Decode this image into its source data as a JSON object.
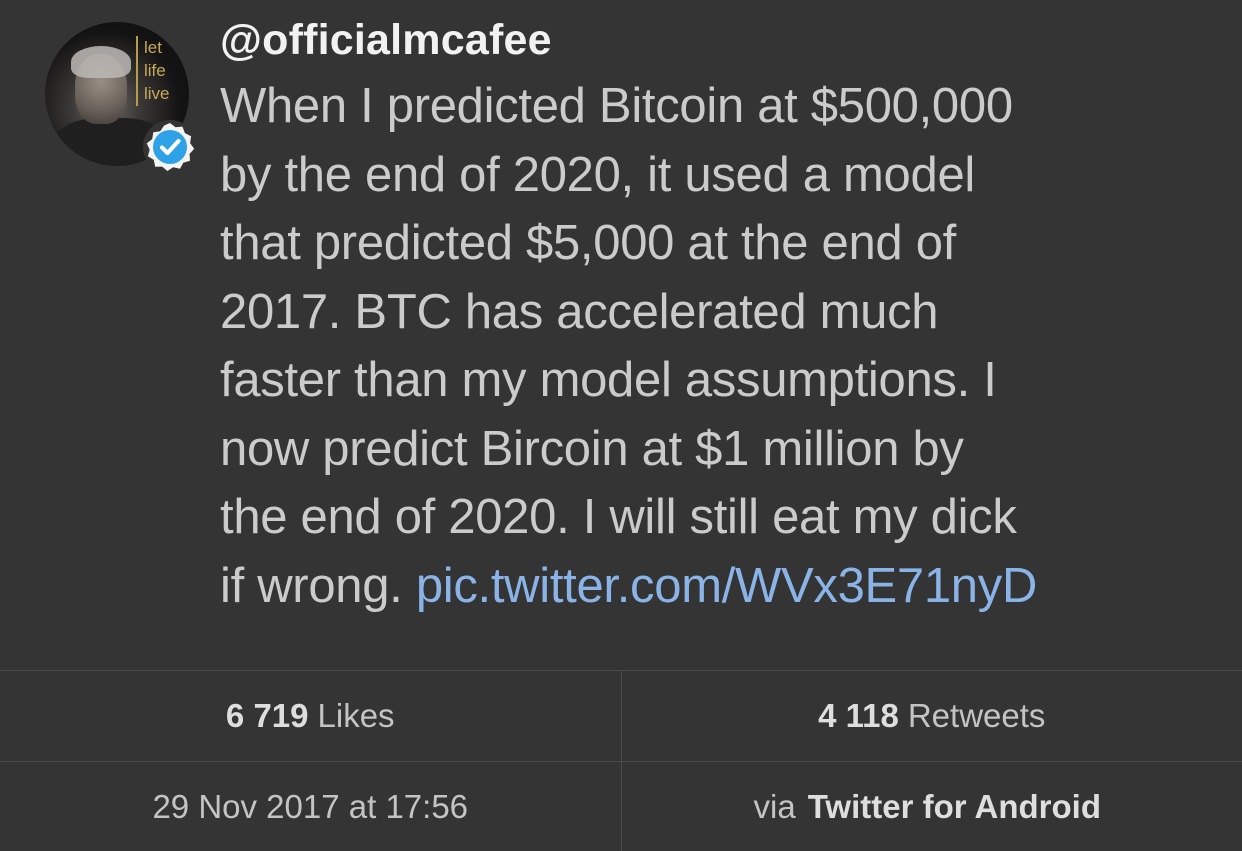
{
  "tweet": {
    "handle": "@officialmcafee",
    "avatar_logo": [
      "let",
      "life",
      "live"
    ],
    "verified_icon": "verified-badge-icon",
    "text_lines": [
      "When I predicted Bitcoin at $500,000",
      "by the end of 2020, it used a model",
      "that predicted $5,000 at the end of",
      "2017. BTC has accelerated much",
      "faster than my model assumptions. I",
      "now predict Bircoin at $1 million by",
      "the end of 2020. I will still eat my dick",
      "if wrong. "
    ],
    "link_text": "pic.twitter.com/WVx3E71nyD"
  },
  "stats": {
    "likes_count": "6 719",
    "likes_label": "Likes",
    "retweets_count": "4 118",
    "retweets_label": "Retweets",
    "timestamp": "29 Nov 2017 at 17:56",
    "via_label": "via",
    "source": "Twitter for Android"
  },
  "colors": {
    "background": "#343434",
    "link": "#8ab4e8",
    "verified": "#2fa1e6"
  }
}
